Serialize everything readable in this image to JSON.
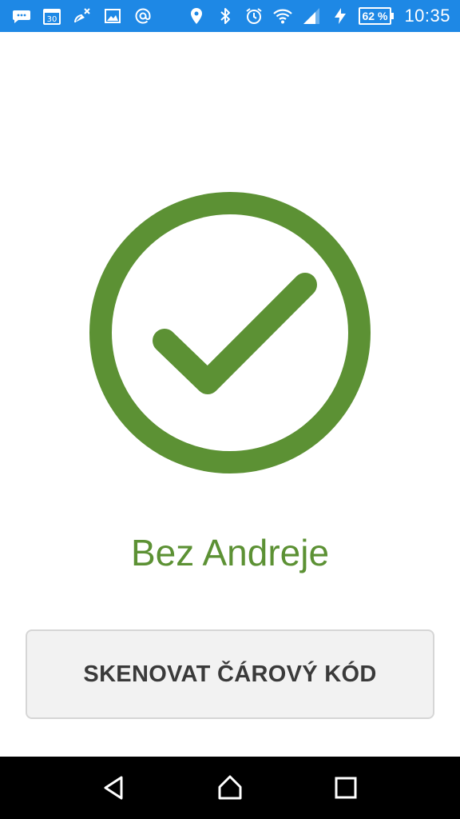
{
  "status_bar": {
    "battery_percent": "62 %",
    "time": "10:35",
    "background_color": "#1e88e5",
    "left_icons": [
      "chat-icon",
      "calendar-icon",
      "satellite-off-icon",
      "image-icon",
      "at-sign-icon"
    ],
    "right_icons": [
      "location-icon",
      "bluetooth-icon",
      "alarm-icon",
      "wifi-icon",
      "signal-icon",
      "charging-icon",
      "battery-icon"
    ]
  },
  "result": {
    "icon": "check-circle-icon",
    "name": "Bez Andreje",
    "color": "#5c9134"
  },
  "scan_button": {
    "label": "SKENOVAT ČÁROVÝ KÓD"
  },
  "nav_bar": {
    "buttons": [
      "back-icon",
      "home-icon",
      "recents-icon"
    ]
  }
}
